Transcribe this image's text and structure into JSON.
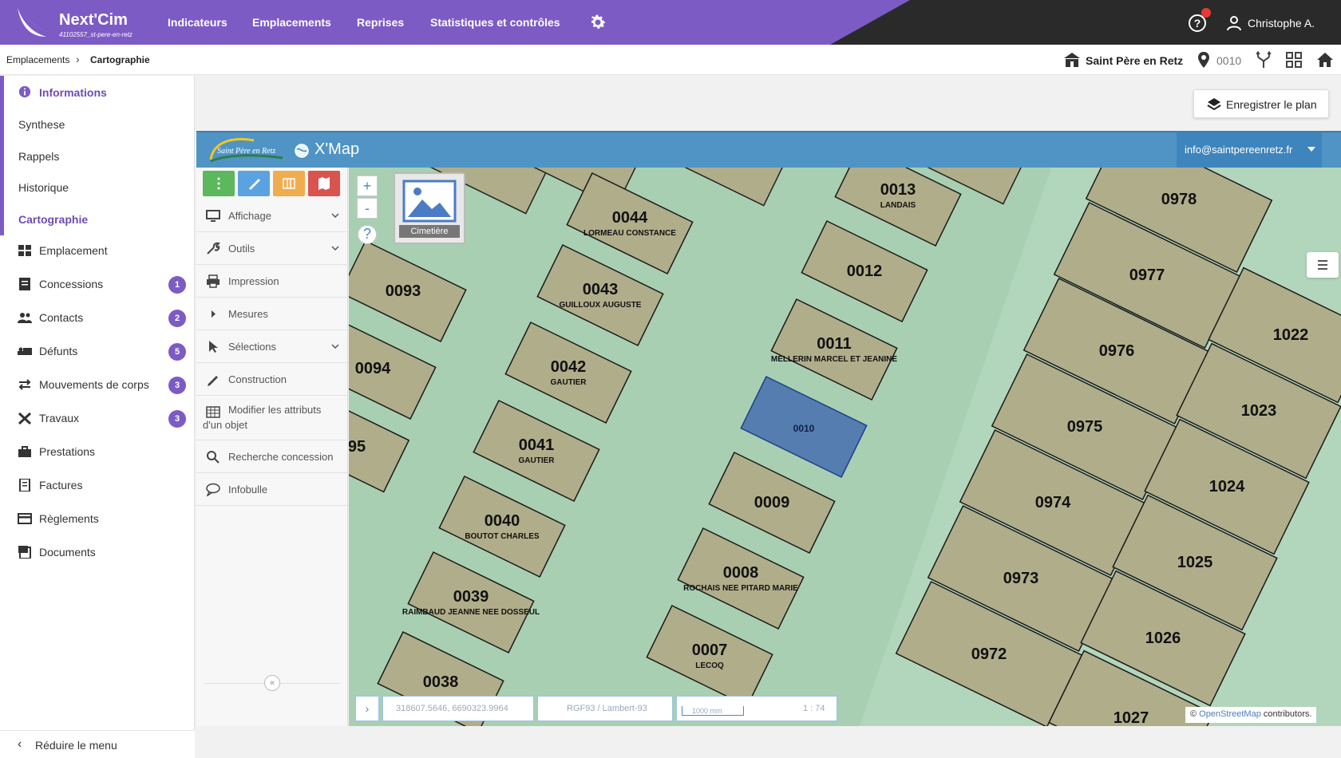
{
  "header": {
    "brand": "Next'Cim",
    "brand_sub": "41102557_st-pere-en-retz",
    "nav": [
      "Indicateurs",
      "Emplacements",
      "Reprises",
      "Statistiques et contrôles"
    ],
    "user": "Christophe A."
  },
  "breadcrumb": {
    "root": "Emplacements",
    "current": "Cartographie"
  },
  "context": {
    "site": "Saint Père en Retz",
    "location_code": "0010"
  },
  "sidebar": {
    "items": [
      {
        "label": "Informations",
        "badge": ""
      },
      {
        "label": "Synthese",
        "badge": ""
      },
      {
        "label": "Rappels",
        "badge": ""
      },
      {
        "label": "Historique",
        "badge": ""
      },
      {
        "label": "Cartographie",
        "badge": ""
      },
      {
        "label": "Emplacement",
        "badge": ""
      },
      {
        "label": "Concessions",
        "badge": "1"
      },
      {
        "label": "Contacts",
        "badge": "2"
      },
      {
        "label": "Défunts",
        "badge": "5"
      },
      {
        "label": "Mouvements de corps",
        "badge": "3"
      },
      {
        "label": "Travaux",
        "badge": "3"
      },
      {
        "label": "Prestations",
        "badge": ""
      },
      {
        "label": "Factures",
        "badge": ""
      },
      {
        "label": "Règlements",
        "badge": ""
      },
      {
        "label": "Documents",
        "badge": ""
      }
    ],
    "reduce": "Réduire le menu"
  },
  "save_plan": "Enregistrer le plan",
  "map_header": {
    "logo_text": "Saint Père en Retz",
    "title": "X'Map",
    "email": "info@saintpereenretz.fr"
  },
  "tool_panel": {
    "colors": [
      "#5cb85c",
      "#5aa3e0",
      "#f0ad4e",
      "#d9534f"
    ],
    "items": [
      "Affichage",
      "Outils",
      "Impression",
      "Mesures",
      "Sélections",
      "Construction",
      "Modifier les attributs d'un objet",
      "Recherche concession",
      "Infobulle"
    ]
  },
  "map": {
    "layer_label": "Cimetière",
    "zoom_in": "+",
    "zoom_out": "-",
    "coordinates": "318607.5646, 6690323.9964",
    "projection": "RGF93 / Lambert-93",
    "scale_bar": "1000 mm",
    "scale": "1 : 74",
    "attribution_prefix": "©",
    "attribution_link": "OpenStreetMap",
    "attribution_suffix": " contributors.",
    "plots": [
      {
        "code": "0044",
        "name": "LORMEAU CONSTANCE"
      },
      {
        "code": "0043",
        "name": "GUILLOUX AUGUSTE"
      },
      {
        "code": "0042",
        "name": "GAUTIER"
      },
      {
        "code": "0041",
        "name": "GAUTIER"
      },
      {
        "code": "0040",
        "name": "BOUTOT CHARLES"
      },
      {
        "code": "0039",
        "name": "RAIMBAUD JEANNE NEE DOSSEUL"
      },
      {
        "code": "0038",
        "name": ""
      },
      {
        "code": "0093",
        "name": ""
      },
      {
        "code": "0094",
        "name": ""
      },
      {
        "code": "95",
        "name": ""
      },
      {
        "code": "0013",
        "name": "LANDAIS"
      },
      {
        "code": "0012",
        "name": ""
      },
      {
        "code": "0011",
        "name": "MELLERIN MARCEL ET JEANINE"
      },
      {
        "code": "0010",
        "name": ""
      },
      {
        "code": "0009",
        "name": ""
      },
      {
        "code": "0008",
        "name": "ROCHAIS NEE PITARD MARIE"
      },
      {
        "code": "0007",
        "name": "LECOQ"
      },
      {
        "code": "0978",
        "name": ""
      },
      {
        "code": "0977",
        "name": ""
      },
      {
        "code": "0976",
        "name": ""
      },
      {
        "code": "0975",
        "name": ""
      },
      {
        "code": "0974",
        "name": ""
      },
      {
        "code": "0973",
        "name": ""
      },
      {
        "code": "0972",
        "name": ""
      },
      {
        "code": "1022",
        "name": ""
      },
      {
        "code": "1023",
        "name": ""
      },
      {
        "code": "1024",
        "name": ""
      },
      {
        "code": "1025",
        "name": ""
      },
      {
        "code": "1026",
        "name": ""
      },
      {
        "code": "1027",
        "name": ""
      }
    ]
  }
}
